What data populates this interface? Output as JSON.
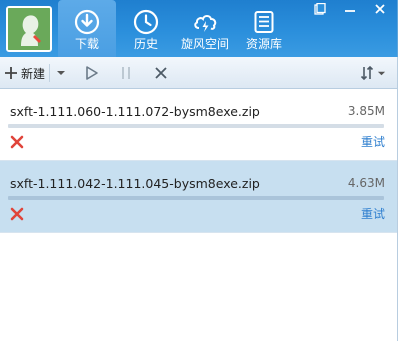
{
  "tabs": [
    {
      "label": "下载",
      "icon": "download-icon",
      "active": true
    },
    {
      "label": "历史",
      "icon": "history-icon",
      "active": false
    },
    {
      "label": "旋风空间",
      "icon": "cloud-space-icon",
      "active": false
    },
    {
      "label": "资源库",
      "icon": "resource-library-icon",
      "active": false
    }
  ],
  "toolbar": {
    "new_label": "新建"
  },
  "downloads": [
    {
      "filename": "sxft-1.111.060-1.111.072-bysm8exe.zip",
      "size": "3.85M",
      "progress": 0,
      "action": "重试",
      "status": "failed"
    },
    {
      "filename": "sxft-1.111.042-1.111.045-bysm8exe.zip",
      "size": "4.63M",
      "progress": 0,
      "action": "重试",
      "status": "failed"
    }
  ],
  "colors": {
    "header": "#2b8fdc",
    "selected_row": "#c7dff0",
    "link": "#2f7fcf",
    "error": "#e0443a"
  }
}
